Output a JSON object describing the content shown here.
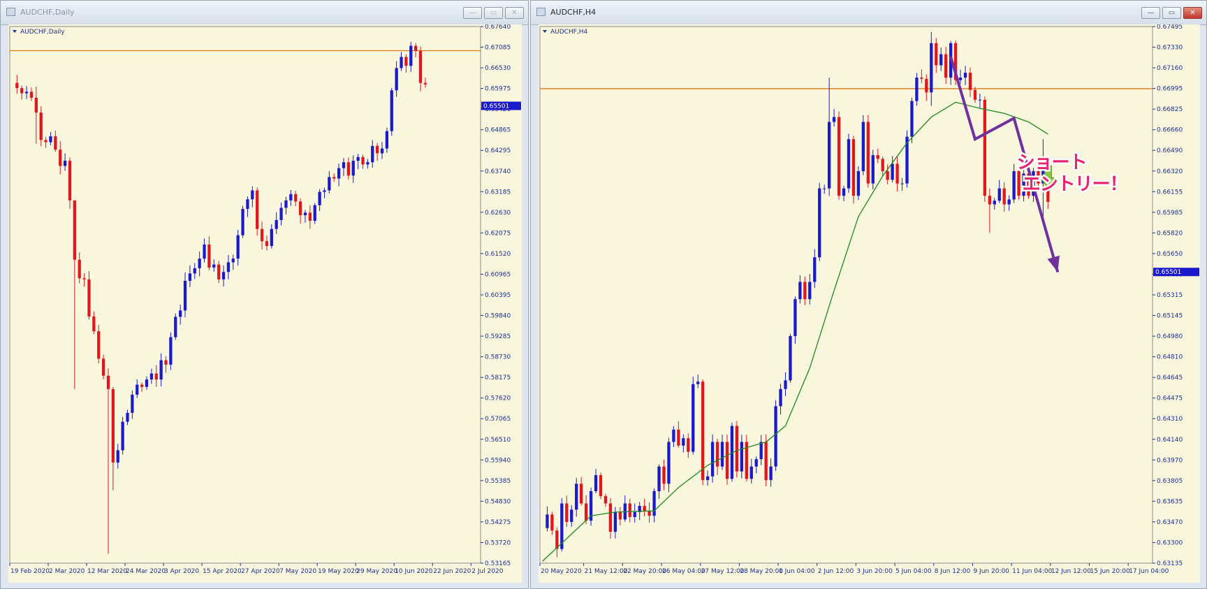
{
  "windows": [
    {
      "title": "AUDCHF,Daily",
      "buttons": [
        "—",
        "▭",
        "✕"
      ]
    },
    {
      "title": "AUDCHF,H4",
      "buttons": [
        "—",
        "▭",
        "✕"
      ]
    }
  ],
  "colors": {
    "bull": "#1a1acc",
    "bear": "#e0181e",
    "level": "#e07a12",
    "ma": "#1c8a1c",
    "axis": "#1f2f8f",
    "arrow": "#7030a0",
    "annotation": "#e8246e",
    "price_tag_bg": "#1a1acc",
    "chart_bg": "#f8f6dc"
  },
  "icons": {
    "window": "chart-window-icon",
    "menu": "triangle-down-icon",
    "down_arrow": "green-down-arrow-icon"
  },
  "chart_data": [
    {
      "type": "candlestick",
      "title": "AUDCHF,Daily",
      "ylim": [
        0.53165,
        0.6764
      ],
      "yticks": [
        "0.67640",
        "0.67085",
        "0.66530",
        "0.65975",
        "0.65420",
        "0.64865",
        "0.64295",
        "0.63740",
        "0.63185",
        "0.62630",
        "0.62075",
        "0.61520",
        "0.60965",
        "0.60395",
        "0.59840",
        "0.59285",
        "0.58730",
        "0.58175",
        "0.57620",
        "0.57065",
        "0.56510",
        "0.55940",
        "0.55385",
        "0.54830",
        "0.54275",
        "0.53720",
        "0.53165"
      ],
      "xlabels": [
        {
          "label": "19 Feb 2020",
          "i": 0
        },
        {
          "label": "2 Mar 2020",
          "i": 8
        },
        {
          "label": "12 Mar 2020",
          "i": 16
        },
        {
          "label": "24 Mar 2020",
          "i": 24
        },
        {
          "label": "3 Apr 2020",
          "i": 32
        },
        {
          "label": "15 Apr 2020",
          "i": 40
        },
        {
          "label": "27 Apr 2020",
          "i": 48
        },
        {
          "label": "7 May 2020",
          "i": 56
        },
        {
          "label": "19 May 2020",
          "i": 64
        },
        {
          "label": "29 May 2020",
          "i": 72
        },
        {
          "label": "10 Jun 2020",
          "i": 80
        },
        {
          "label": "22 Jun 2020",
          "i": 88
        },
        {
          "label": "2 Jul 2020",
          "i": 96
        }
      ],
      "slots": 98,
      "horizontal_line": 0.6699,
      "current_price": "0.65501",
      "current_price_value": 0.65501,
      "anchors": [
        0.6612,
        0.6598,
        0.6584,
        0.6588,
        0.6572,
        0.6532,
        0.6458,
        0.6452,
        0.6468,
        0.6432,
        0.6388,
        0.6402,
        0.6295,
        0.6135,
        0.6085,
        0.6082,
        0.5982,
        0.5942,
        0.5868,
        0.5822,
        0.5786,
        0.5588,
        0.5621,
        0.5698,
        0.5722,
        0.5771,
        0.5798,
        0.5792,
        0.5812,
        0.5828,
        0.5812,
        0.5864,
        0.5852,
        0.5926,
        0.5981,
        0.5998,
        0.6078,
        0.6098,
        0.6112,
        0.6138,
        0.6176,
        0.6114,
        0.6122,
        0.6082,
        0.6102,
        0.6128,
        0.6138,
        0.6201,
        0.6272,
        0.6298,
        0.6322,
        0.6218,
        0.6185,
        0.6172,
        0.6218,
        0.6242,
        0.6275,
        0.6295,
        0.6312,
        0.6292,
        0.6255,
        0.6262,
        0.624,
        0.6282,
        0.6318,
        0.6322,
        0.6358,
        0.6354,
        0.6382,
        0.6398,
        0.6362,
        0.6402,
        0.6412,
        0.6392,
        0.6398,
        0.6442,
        0.6422,
        0.6435,
        0.6482,
        0.6592,
        0.6652,
        0.6682,
        0.6658,
        0.6712,
        0.6698,
        0.6612,
        0.6608
      ],
      "wick_overrides": {
        "13": [
          0.6204,
          0.5786
        ],
        "20": [
          0.5842,
          0.5342
        ],
        "21": [
          0.5792,
          0.5513
        ],
        "5": [
          0.6602,
          0.6448
        ]
      }
    },
    {
      "type": "candlestick",
      "title": "AUDCHF,H4",
      "ylim": [
        0.63135,
        0.67495
      ],
      "yticks": [
        "0.67495",
        "0.67330",
        "0.67160",
        "0.66995",
        "0.66825",
        "0.66660",
        "0.66490",
        "0.66320",
        "0.66155",
        "0.65985",
        "0.65820",
        "0.65650",
        "0.65480",
        "0.65315",
        "0.65145",
        "0.64980",
        "0.64810",
        "0.64645",
        "0.64475",
        "0.64310",
        "0.64140",
        "0.63970",
        "0.63805",
        "0.63635",
        "0.63470",
        "0.63300",
        "0.63135"
      ],
      "xlabels": [
        {
          "label": "20 May 2020",
          "i": 0
        },
        {
          "label": "21 May 12:00",
          "i": 9
        },
        {
          "label": "22 May 20:00",
          "i": 17
        },
        {
          "label": "26 May 04:00",
          "i": 25
        },
        {
          "label": "27 May 12:00",
          "i": 33
        },
        {
          "label": "28 May 20:00",
          "i": 41
        },
        {
          "label": "1 Jun 04:00",
          "i": 49
        },
        {
          "label": "2 Jun 12:00",
          "i": 57
        },
        {
          "label": "3 Jun 20:00",
          "i": 65
        },
        {
          "label": "5 Jun 04:00",
          "i": 73
        },
        {
          "label": "8 Jun 12:00",
          "i": 81
        },
        {
          "label": "9 Jun 20:00",
          "i": 89
        },
        {
          "label": "11 Jun 04:00",
          "i": 97
        },
        {
          "label": "12 Jun 12:00",
          "i": 105
        },
        {
          "label": "15 Jun 20:00",
          "i": 113
        },
        {
          "label": "17 Jun 04:00",
          "i": 121
        }
      ],
      "slots": 126,
      "horizontal_line": 0.6699,
      "current_price": "0.65501",
      "current_price_value": 0.65501,
      "anchors": [
        0.6342,
        0.6353,
        0.634,
        0.6325,
        0.6362,
        0.6347,
        0.6357,
        0.6378,
        0.6362,
        0.6348,
        0.6372,
        0.6385,
        0.6368,
        0.6362,
        0.6339,
        0.6355,
        0.6349,
        0.6362,
        0.6351,
        0.6355,
        0.636,
        0.6356,
        0.6352,
        0.6372,
        0.6392,
        0.6378,
        0.6412,
        0.6422,
        0.6409,
        0.6415,
        0.6404,
        0.6459,
        0.6461,
        0.6381,
        0.6384,
        0.6412,
        0.6392,
        0.6412,
        0.6382,
        0.6425,
        0.6388,
        0.6412,
        0.6382,
        0.6392,
        0.6398,
        0.6412,
        0.6381,
        0.6392,
        0.6441,
        0.6455,
        0.6462,
        0.6498,
        0.6528,
        0.6542,
        0.6528,
        0.6542,
        0.6562,
        0.6618,
        0.6618,
        0.6672,
        0.6676,
        0.6612,
        0.6618,
        0.6658,
        0.6612,
        0.6632,
        0.6672,
        0.6622,
        0.6645,
        0.6642,
        0.6632,
        0.6625,
        0.6638,
        0.6622,
        0.6622,
        0.666,
        0.6689,
        0.6708,
        0.6707,
        0.6696,
        0.6736,
        0.6718,
        0.6727,
        0.6708,
        0.6736,
        0.6706,
        0.6708,
        0.6712,
        0.6698,
        0.669,
        0.669,
        0.6612,
        0.6605,
        0.6608,
        0.6618,
        0.6605,
        0.6609,
        0.6632,
        0.6612,
        0.663,
        0.6612,
        0.6632,
        0.6622,
        0.6634,
        0.6607
      ],
      "ma_anchors": [
        {
          "i": 0,
          "v": 0.6315
        },
        {
          "i": 10,
          "v": 0.6352
        },
        {
          "i": 15,
          "v": 0.6355
        },
        {
          "i": 23,
          "v": 0.6356
        },
        {
          "i": 28,
          "v": 0.6375
        },
        {
          "i": 34,
          "v": 0.6393
        },
        {
          "i": 40,
          "v": 0.6405
        },
        {
          "i": 46,
          "v": 0.6412
        },
        {
          "i": 50,
          "v": 0.6425
        },
        {
          "i": 55,
          "v": 0.6472
        },
        {
          "i": 60,
          "v": 0.6535
        },
        {
          "i": 65,
          "v": 0.6595
        },
        {
          "i": 70,
          "v": 0.6628
        },
        {
          "i": 75,
          "v": 0.6655
        },
        {
          "i": 80,
          "v": 0.6676
        },
        {
          "i": 85,
          "v": 0.6688
        },
        {
          "i": 90,
          "v": 0.6683
        },
        {
          "i": 95,
          "v": 0.6679
        },
        {
          "i": 100,
          "v": 0.6672
        },
        {
          "i": 104,
          "v": 0.6662
        }
      ],
      "wick_overrides": {
        "59": [
          0.6708,
          0.6612
        ],
        "80": [
          0.6745,
          0.6685
        ],
        "92": [
          0.6618,
          0.6582
        ],
        "103": [
          0.6658,
          0.6592
        ]
      },
      "annotations": {
        "text_lines": [
          "ショート",
          "エントリー！"
        ],
        "polyline": [
          {
            "i": 84,
            "v": 0.6725
          },
          {
            "i": 89,
            "v": 0.6658
          },
          {
            "i": 97,
            "v": 0.6675
          },
          {
            "i": 106,
            "v": 0.655
          }
        ],
        "down_arrow_at": {
          "i": 104,
          "v": 0.6625
        }
      }
    }
  ]
}
